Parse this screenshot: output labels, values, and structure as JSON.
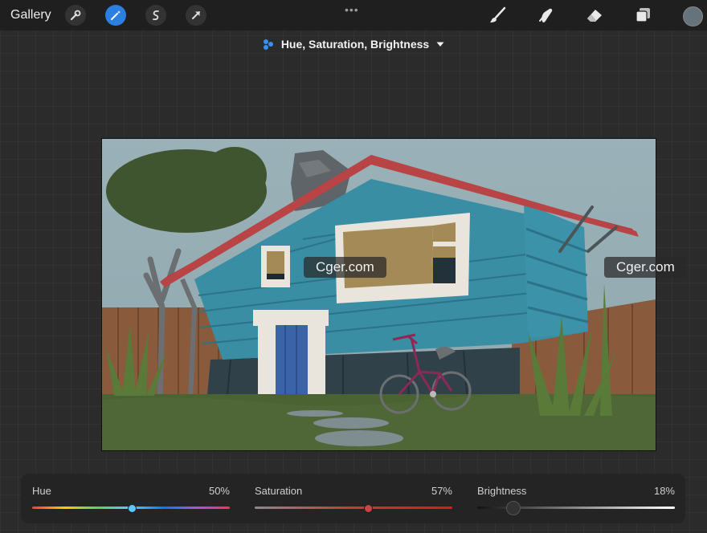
{
  "toolbar": {
    "gallery_label": "Gallery",
    "left_tools": [
      {
        "name": "actions",
        "icon": "wrench-icon",
        "active": false
      },
      {
        "name": "adjustments",
        "icon": "magic-wand-icon",
        "active": true
      },
      {
        "name": "selection",
        "icon": "selection-s-icon",
        "active": false
      },
      {
        "name": "transform",
        "icon": "arrow-cursor-icon",
        "active": false
      }
    ],
    "more_label": "•••",
    "right_tools": [
      "brush-icon",
      "smudge-icon",
      "eraser-icon",
      "layers-icon"
    ],
    "current_color": "#64747a",
    "accent_color": "#2a7fe0"
  },
  "adjustment": {
    "title": "Hue, Saturation, Brightness",
    "icon": "hsb-dots-icon",
    "dropdown_icon": "triangle-down-icon"
  },
  "canvas": {
    "description_icon": "artwork",
    "watermarks": [
      "Cger.com",
      "Cger.com"
    ]
  },
  "sliders": [
    {
      "name": "Hue",
      "value_label": "50%",
      "value": 0.5
    },
    {
      "name": "Saturation",
      "value_label": "57%",
      "value": 0.57
    },
    {
      "name": "Brightness",
      "value_label": "18%",
      "value": 0.18
    }
  ]
}
